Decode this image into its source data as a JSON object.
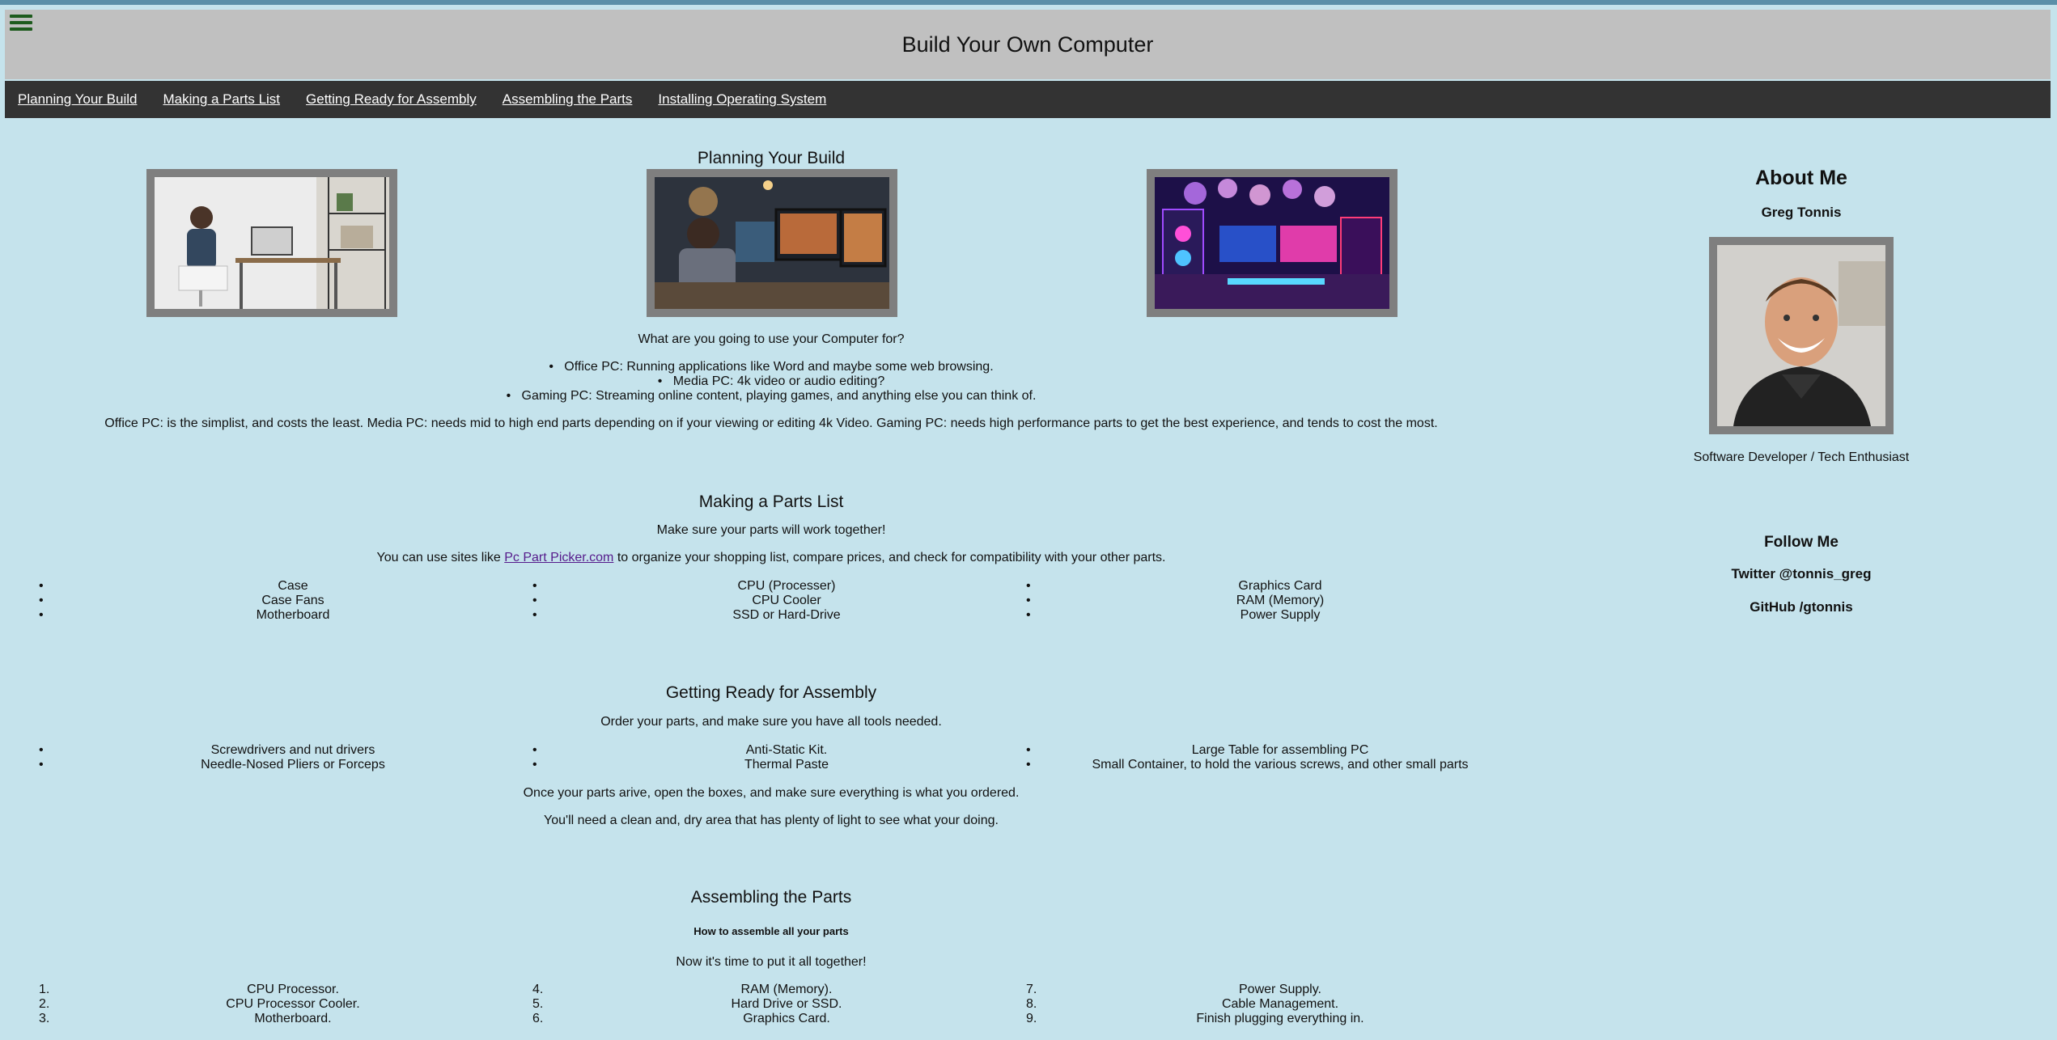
{
  "header": {
    "title": "Build Your Own Computer",
    "menu_icon": "hamburger-menu-icon"
  },
  "nav": {
    "items": [
      "Planning Your Build",
      "Making a Parts List",
      "Getting Ready for Assembly",
      "Assembling the Parts",
      "Installing Operating System"
    ]
  },
  "planning": {
    "title": "Planning Your Build",
    "question": "What are you going to use your Computer for?",
    "uses": [
      "Office PC: Running applications like Word and maybe some web browsing.",
      "Media PC: 4k video or audio editing?",
      "Gaming PC: Streaming online content, playing games, and anything else you can think of."
    ],
    "summary": "Office PC: is the simplist, and costs the least. Media PC: needs mid to high end parts depending on if your viewing or editing 4k Video. Gaming PC: needs high performance parts to get the best experience, and tends to cost the most."
  },
  "parts": {
    "title": "Making a Parts List",
    "subtitle": "Make sure your parts will work together!",
    "sites_pre": "You can use sites like ",
    "sites_link": "Pc Part Picker.com",
    "sites_post": " to organize your shopping list, compare prices, and check for compatibility with your other parts.",
    "col1": [
      "Case",
      "Case Fans",
      "Motherboard"
    ],
    "col2": [
      "CPU (Processer)",
      "CPU Cooler",
      "SSD or Hard-Drive"
    ],
    "col3": [
      "Graphics Card",
      "RAM (Memory)",
      "Power Supply"
    ]
  },
  "ready": {
    "title": "Getting Ready for Assembly",
    "subtitle": "Order your parts, and make sure you have all tools needed.",
    "col1": [
      "Screwdrivers and nut drivers",
      "Needle-Nosed Pliers or Forceps"
    ],
    "col2": [
      "Anti-Static Kit.",
      "Thermal Paste"
    ],
    "col3": [
      "Large Table for assembling PC",
      "Small Container, to hold the various screws, and other small parts"
    ],
    "note1": "Once your parts arive, open the boxes, and make sure everything is what you ordered.",
    "note2": "You'll need a clean and, dry area that has plenty of light to see what your doing."
  },
  "assembling": {
    "title": "Assembling the Parts",
    "subtitle": "How to assemble all your parts",
    "intro": "Now it's time to put it all together!",
    "col1": [
      "CPU Processor.",
      "CPU Processor Cooler.",
      "Motherboard."
    ],
    "col2": [
      "RAM (Memory).",
      "Hard Drive or SSD.",
      "Graphics Card."
    ],
    "col3": [
      "Power Supply.",
      "Cable Management.",
      "Finish plugging everything in."
    ],
    "numbers": [
      "1.",
      "2.",
      "3.",
      "4.",
      "5.",
      "6.",
      "7.",
      "8.",
      "9."
    ]
  },
  "about": {
    "title": "About Me",
    "name": "Greg Tonnis",
    "role": "Software Developer / Tech Enthusiast",
    "follow_title": "Follow Me",
    "twitter": "Twitter @tonnis_greg",
    "github": "GitHub /gtonnis"
  }
}
